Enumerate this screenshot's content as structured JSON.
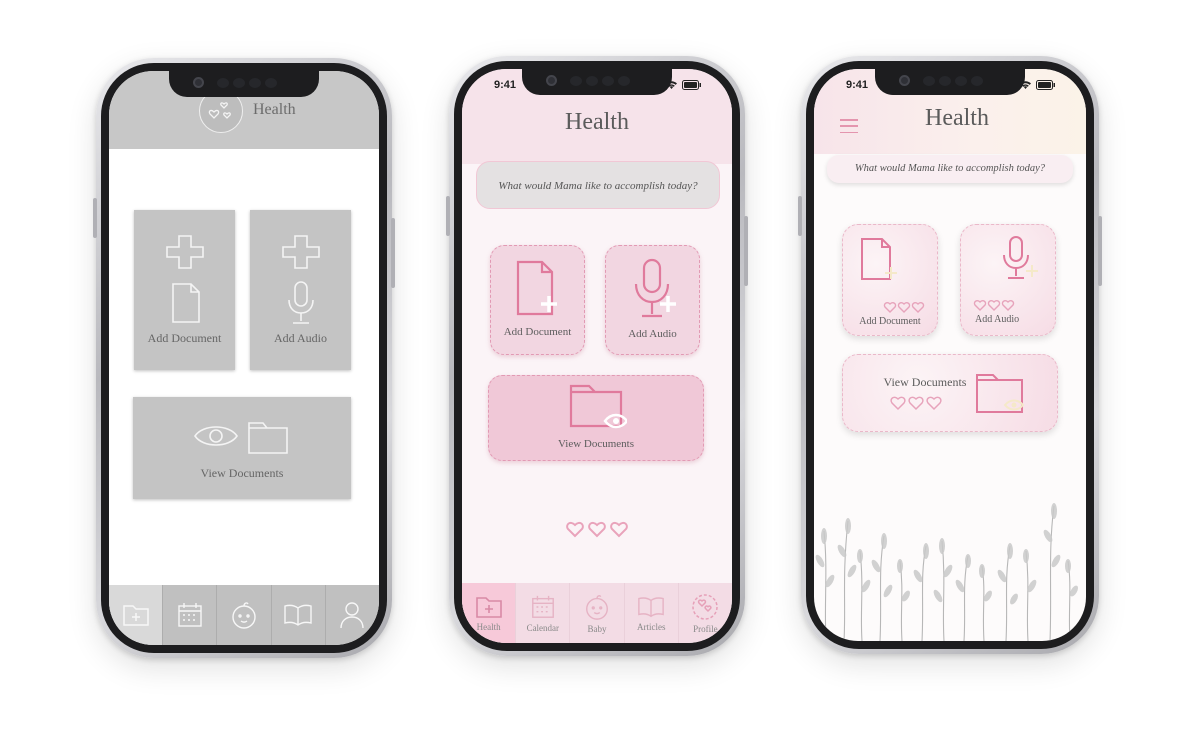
{
  "wireframe": {
    "header_title": "Health",
    "add_document_label": "Add Document",
    "add_audio_label": "Add Audio",
    "view_documents_label": "View Documents",
    "tabs": [
      "health-icon",
      "calendar-icon",
      "baby-icon",
      "articles-icon",
      "profile-icon"
    ]
  },
  "pink": {
    "status_time": "9:41",
    "title": "Health",
    "prompt": "What would Mama like to accomplish today?",
    "add_document_label": "Add Document",
    "add_audio_label": "Add Audio",
    "view_documents_label": "View Documents",
    "tabs": [
      {
        "label": "Health",
        "icon": "health-folder-icon"
      },
      {
        "label": "Calendar",
        "icon": "calendar-icon"
      },
      {
        "label": "Baby",
        "icon": "baby-icon"
      },
      {
        "label": "Articles",
        "icon": "book-icon"
      },
      {
        "label": "Profile",
        "icon": "profile-icon"
      }
    ]
  },
  "blush": {
    "status_time": "9:41",
    "title": "Health",
    "prompt": "What would Mama like to accomplish today?",
    "add_document_label": "Add Document",
    "add_audio_label": "Add Audio",
    "view_documents_label": "View Documents"
  },
  "colors": {
    "wire_gray": "#c4c4c4",
    "pink_accent": "#e495ae",
    "pink_card": "#f2d6e1"
  }
}
